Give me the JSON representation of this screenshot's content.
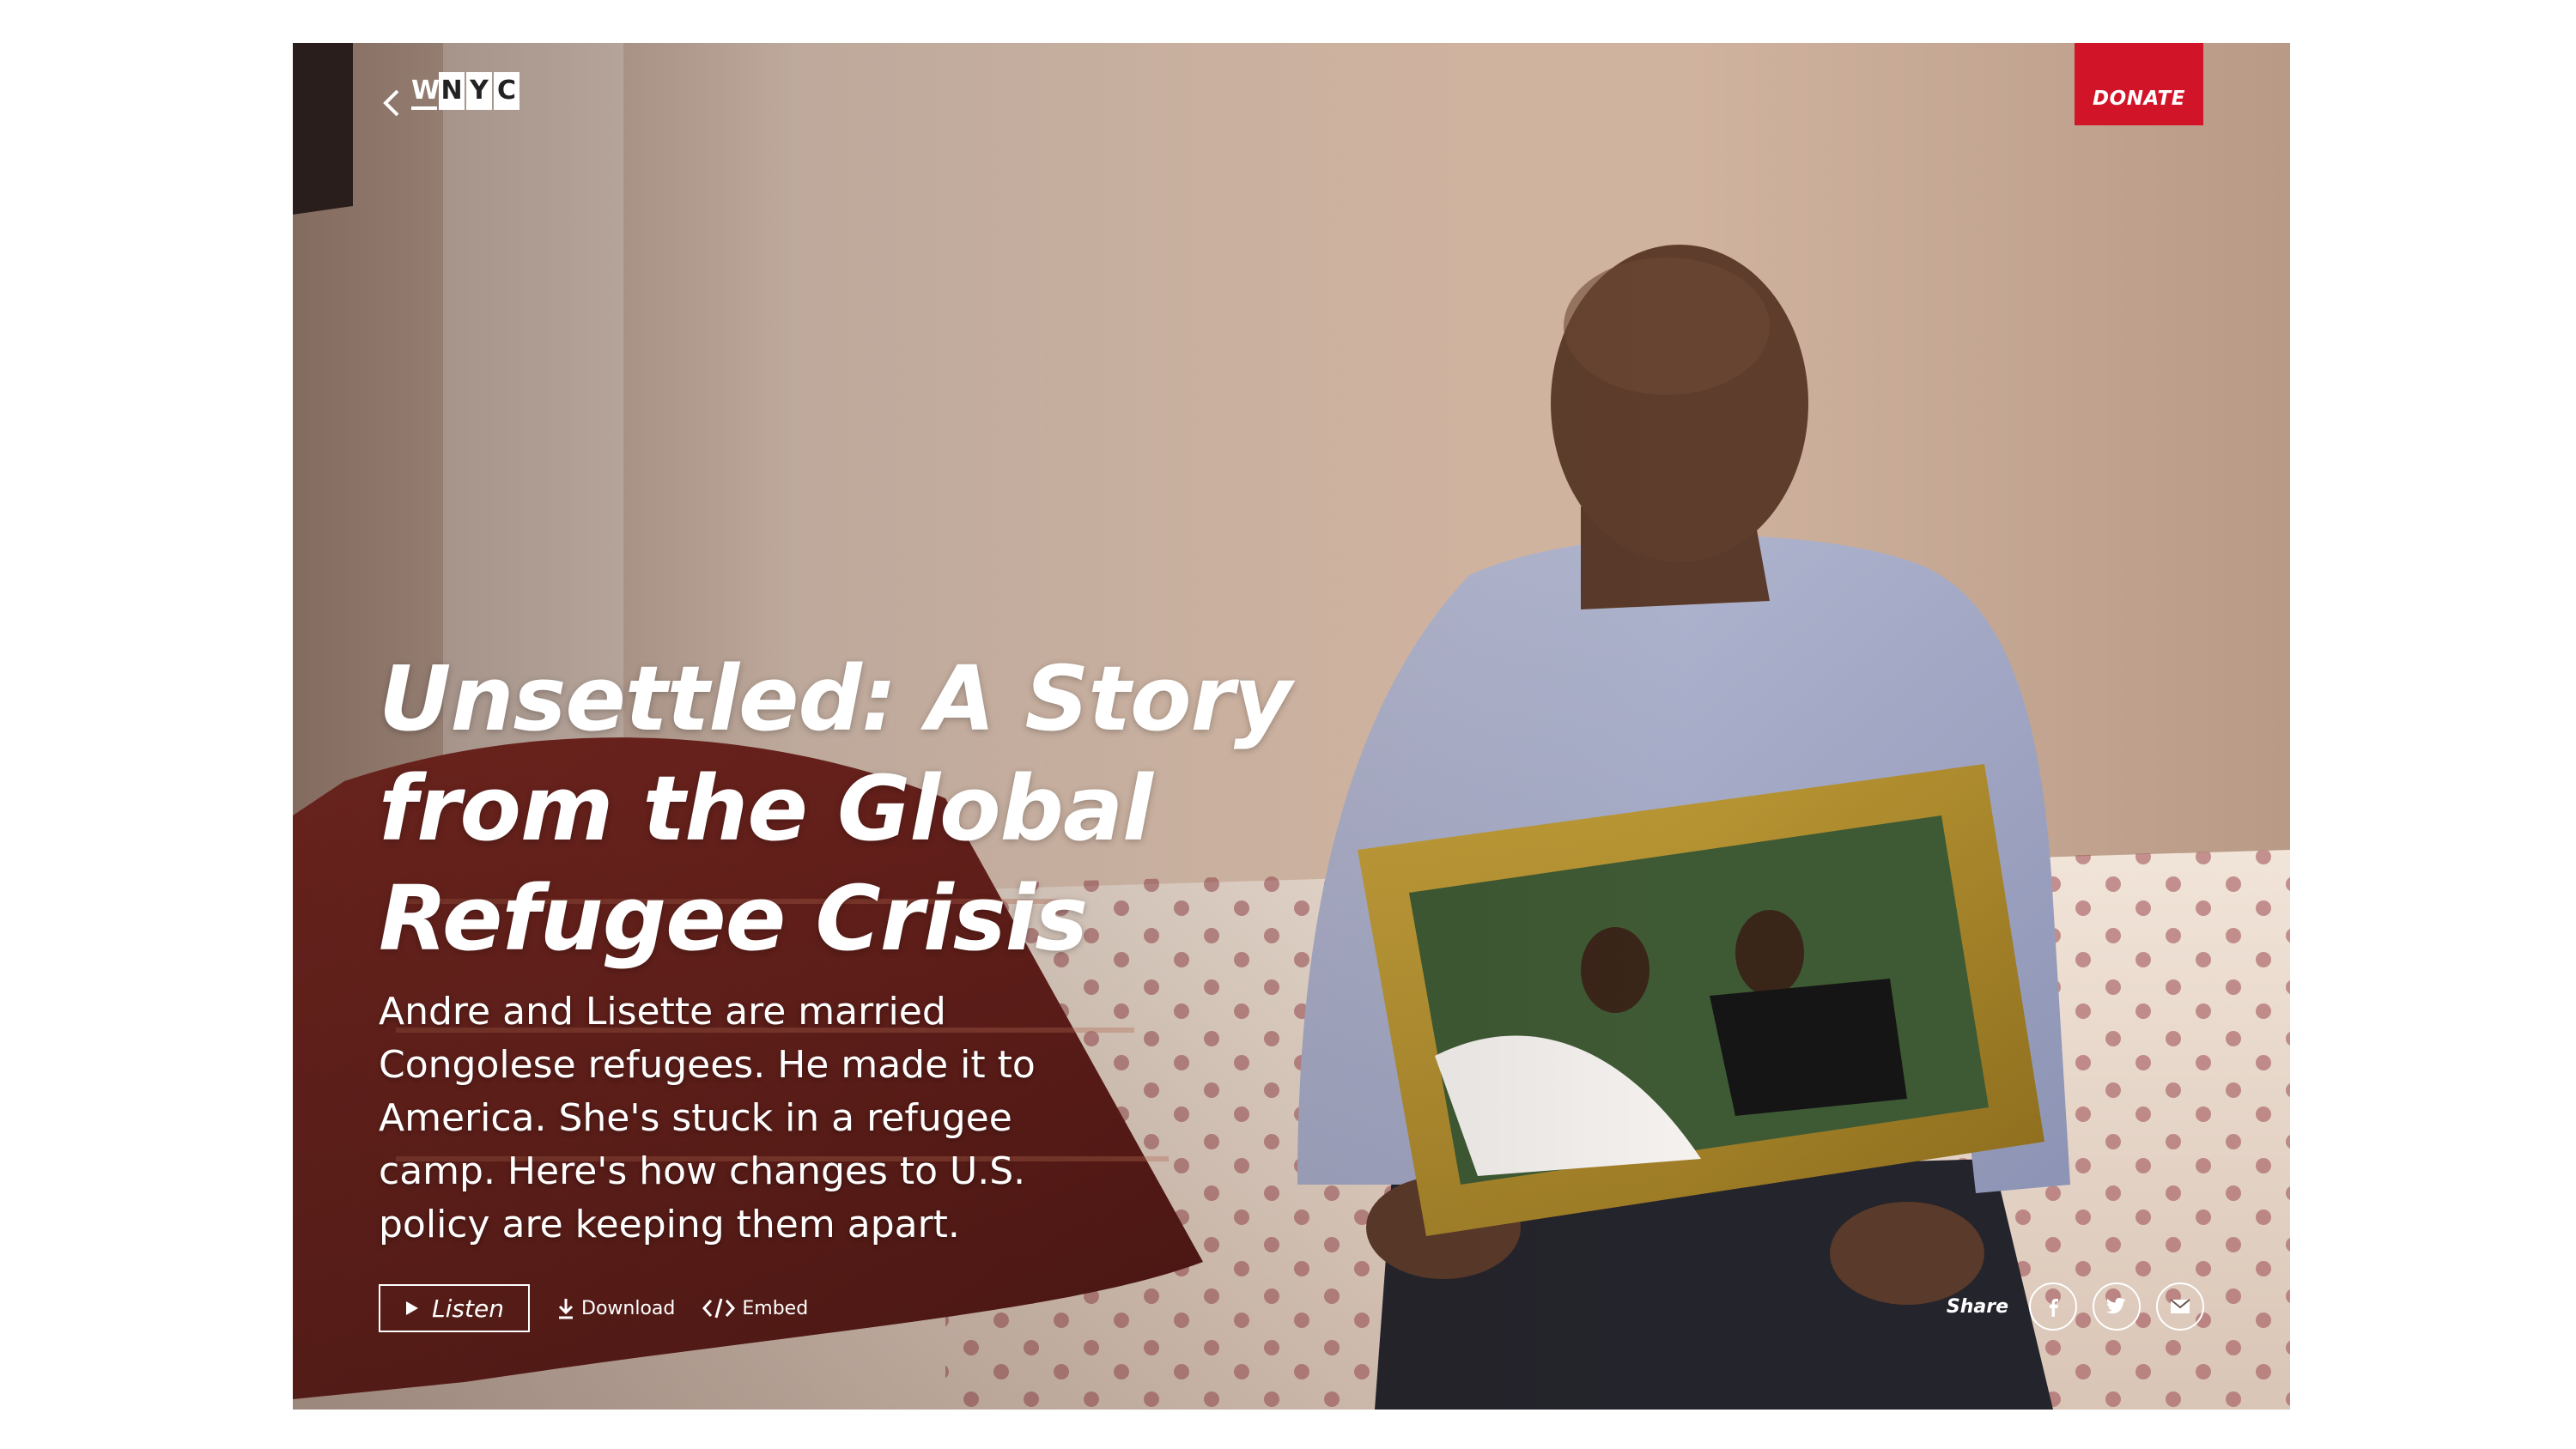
{
  "header": {
    "logo_letters": [
      "W",
      "N",
      "Y",
      "C"
    ],
    "donate_label": "DONATE"
  },
  "story": {
    "title_line1": "Unsettled: A Story",
    "title_line2": "from the Global",
    "title_line3": "Refugee Crisis",
    "dek": "Andre and Lisette are married Congolese refugees. He made it to America. She's stuck in a refugee camp. Here's how changes to U.S. policy are keeping them apart."
  },
  "actions": {
    "listen_label": "Listen",
    "download_label": "Download",
    "embed_label": "Embed"
  },
  "share": {
    "label": "Share",
    "buttons": [
      "facebook-icon",
      "twitter-icon",
      "email-icon"
    ]
  },
  "colors": {
    "donate_bg": "#d11427",
    "text": "#ffffff"
  }
}
